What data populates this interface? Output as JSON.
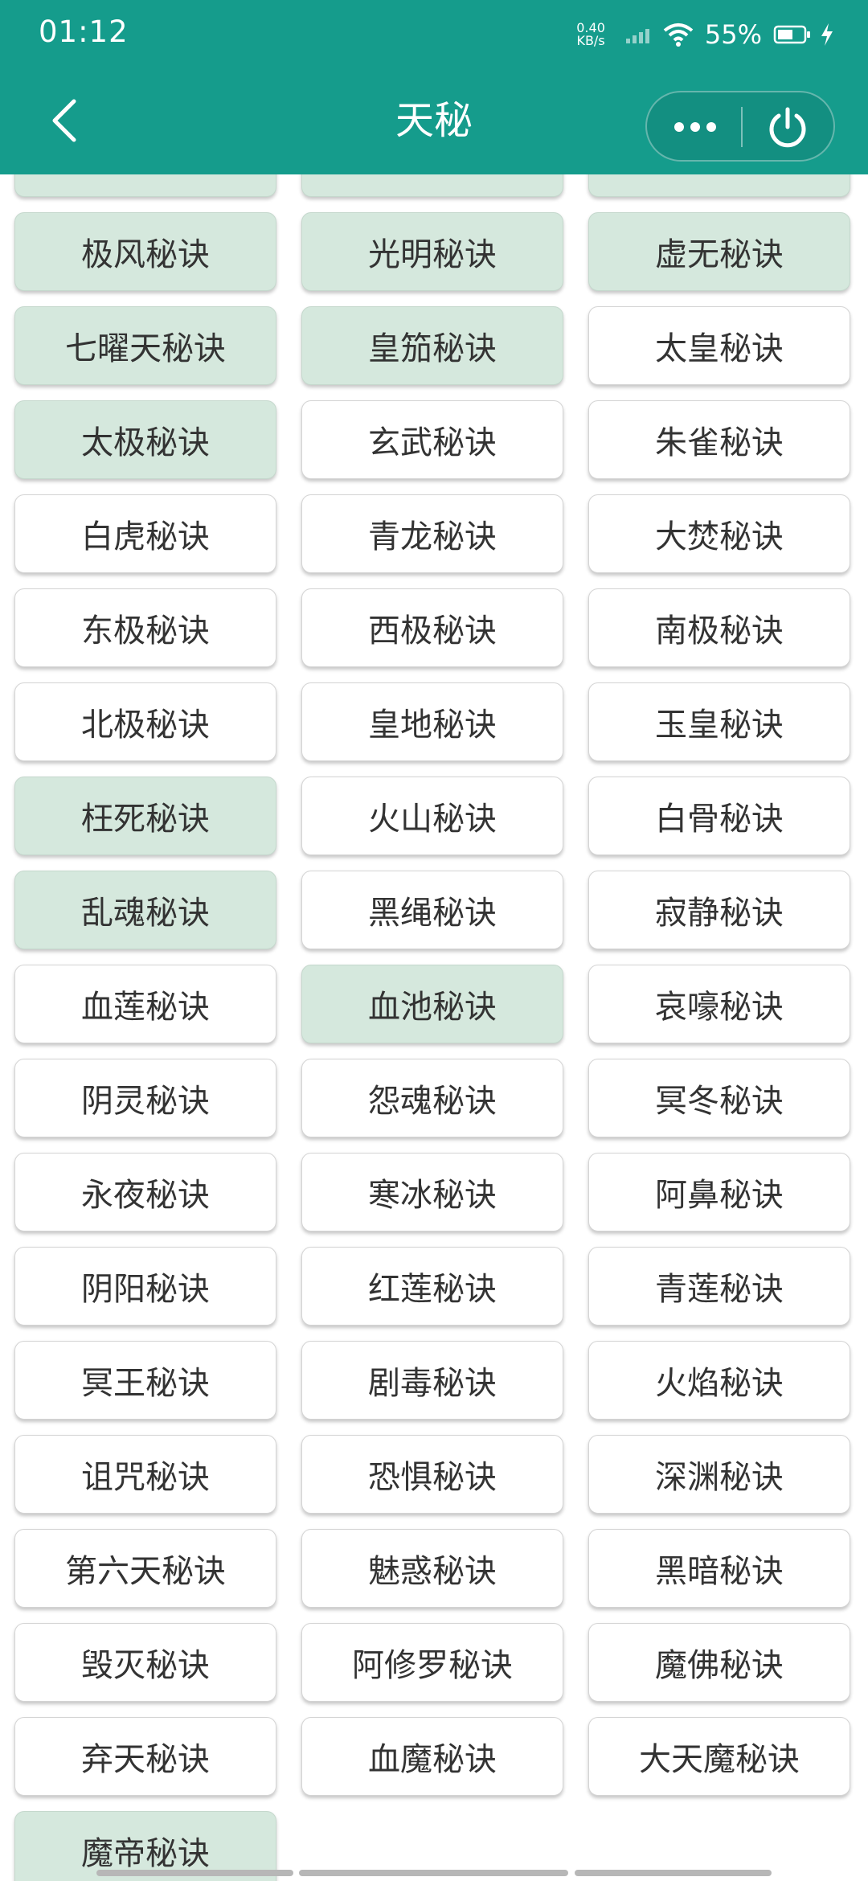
{
  "status_bar": {
    "time": "01:12",
    "net_speed_value": "0.40",
    "net_speed_unit": "KB/s",
    "battery_percent": "55%"
  },
  "nav": {
    "title": "天秘"
  },
  "colors": {
    "header_bg": "#159c8c",
    "selected_bg": "#d5e8dd",
    "item_bg": "#ffffff",
    "text": "#333333"
  },
  "items": [
    {
      "label": "",
      "selected": true
    },
    {
      "label": "",
      "selected": true
    },
    {
      "label": "",
      "selected": true
    },
    {
      "label": "极风秘诀",
      "selected": true
    },
    {
      "label": "光明秘诀",
      "selected": true
    },
    {
      "label": "虚无秘诀",
      "selected": true
    },
    {
      "label": "七曜天秘诀",
      "selected": true
    },
    {
      "label": "皇笳秘诀",
      "selected": true
    },
    {
      "label": "太皇秘诀",
      "selected": false
    },
    {
      "label": "太极秘诀",
      "selected": true
    },
    {
      "label": "玄武秘诀",
      "selected": false
    },
    {
      "label": "朱雀秘诀",
      "selected": false
    },
    {
      "label": "白虎秘诀",
      "selected": false
    },
    {
      "label": "青龙秘诀",
      "selected": false
    },
    {
      "label": "大焚秘诀",
      "selected": false
    },
    {
      "label": "东极秘诀",
      "selected": false
    },
    {
      "label": "西极秘诀",
      "selected": false
    },
    {
      "label": "南极秘诀",
      "selected": false
    },
    {
      "label": "北极秘诀",
      "selected": false
    },
    {
      "label": "皇地秘诀",
      "selected": false
    },
    {
      "label": "玉皇秘诀",
      "selected": false
    },
    {
      "label": "枉死秘诀",
      "selected": true
    },
    {
      "label": "火山秘诀",
      "selected": false
    },
    {
      "label": "白骨秘诀",
      "selected": false
    },
    {
      "label": "乱魂秘诀",
      "selected": true
    },
    {
      "label": "黑绳秘诀",
      "selected": false
    },
    {
      "label": "寂静秘诀",
      "selected": false
    },
    {
      "label": "血莲秘诀",
      "selected": false
    },
    {
      "label": "血池秘诀",
      "selected": true
    },
    {
      "label": "哀嚎秘诀",
      "selected": false
    },
    {
      "label": "阴灵秘诀",
      "selected": false
    },
    {
      "label": "怨魂秘诀",
      "selected": false
    },
    {
      "label": "冥冬秘诀",
      "selected": false
    },
    {
      "label": "永夜秘诀",
      "selected": false
    },
    {
      "label": "寒冰秘诀",
      "selected": false
    },
    {
      "label": "阿鼻秘诀",
      "selected": false
    },
    {
      "label": "阴阳秘诀",
      "selected": false
    },
    {
      "label": "红莲秘诀",
      "selected": false
    },
    {
      "label": "青莲秘诀",
      "selected": false
    },
    {
      "label": "冥王秘诀",
      "selected": false
    },
    {
      "label": "剧毒秘诀",
      "selected": false
    },
    {
      "label": "火焰秘诀",
      "selected": false
    },
    {
      "label": "诅咒秘诀",
      "selected": false
    },
    {
      "label": "恐惧秘诀",
      "selected": false
    },
    {
      "label": "深渊秘诀",
      "selected": false
    },
    {
      "label": "第六天秘诀",
      "selected": false
    },
    {
      "label": "魅惑秘诀",
      "selected": false
    },
    {
      "label": "黑暗秘诀",
      "selected": false
    },
    {
      "label": "毁灭秘诀",
      "selected": false
    },
    {
      "label": "阿修罗秘诀",
      "selected": false
    },
    {
      "label": "魔佛秘诀",
      "selected": false
    },
    {
      "label": "弃天秘诀",
      "selected": false
    },
    {
      "label": "血魔秘诀",
      "selected": false
    },
    {
      "label": "大天魔秘诀",
      "selected": false
    },
    {
      "label": "魔帝秘诀",
      "selected": true
    }
  ]
}
